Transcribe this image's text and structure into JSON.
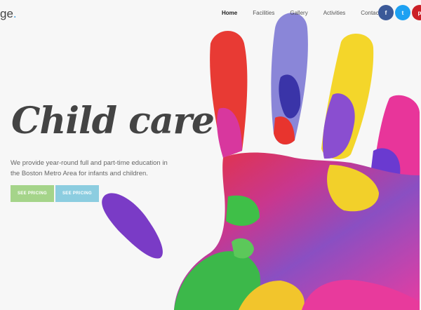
{
  "brand": {
    "logo_text": "ge",
    "logo_dot": "."
  },
  "nav": {
    "items": [
      "Home",
      "Facilities",
      "Gallery",
      "Activities",
      "Contact"
    ],
    "active": "Home"
  },
  "social": {
    "facebook": "f",
    "twitter": "t",
    "pinterest": "p",
    "colors": {
      "facebook": "#3b5998",
      "twitter": "#1da1f2",
      "pinterest": "#cb2027"
    }
  },
  "hero": {
    "headline": "Child care",
    "subtext": "We provide year-round full and part-time education in the Boston Metro Area for infants and children.",
    "button_primary": "SEE PRICING",
    "button_secondary": "SEE PRICING",
    "colors": {
      "primary_button": "#a5d48a",
      "secondary_button": "#8ccde0"
    }
  }
}
